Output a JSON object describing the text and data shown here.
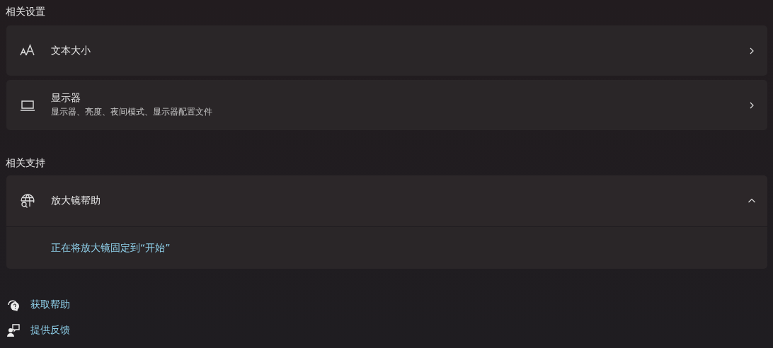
{
  "related_settings": {
    "heading": "相关设置",
    "items": [
      {
        "title": "文本大小"
      },
      {
        "title": "显示器",
        "subtitle": "显示器、亮度、夜间模式、显示器配置文件"
      }
    ]
  },
  "related_support": {
    "heading": "相关支持",
    "expander": {
      "title": "放大镜帮助",
      "expanded": true,
      "links": [
        "正在将放大镜固定到“开始”"
      ]
    }
  },
  "footer_links": [
    {
      "label": "获取帮助"
    },
    {
      "label": "提供反馈"
    }
  ]
}
